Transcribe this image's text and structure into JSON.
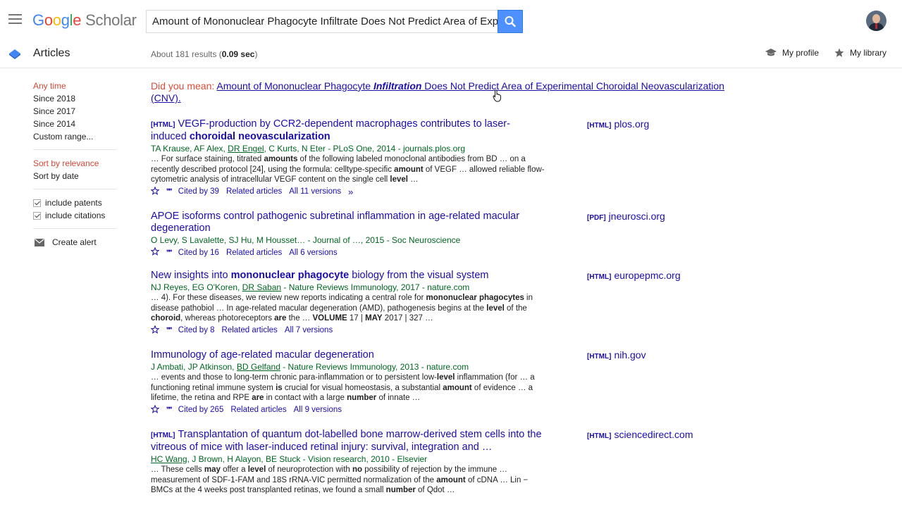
{
  "header": {
    "logo_google": "Google",
    "logo_scholar": "Scholar",
    "search_query": "Amount of Mononuclear Phagocyte Infiltrate Does Not Predict Area of Experi"
  },
  "subbar": {
    "section": "Articles",
    "results_prefix": "About 181 results (",
    "results_time": "0.09 sec",
    "results_suffix": ")",
    "my_profile": "My profile",
    "my_library": "My library"
  },
  "sidebar": {
    "time_filters": [
      "Any time",
      "Since 2018",
      "Since 2017",
      "Since 2014",
      "Custom range..."
    ],
    "sort": [
      "Sort by relevance",
      "Sort by date"
    ],
    "include_patents": "include patents",
    "include_citations": "include citations",
    "create_alert": "Create alert"
  },
  "did_you_mean": {
    "prefix": "Did you mean:",
    "pre": "Amount of Mononuclear Phagocyte ",
    "bold": "Infiltration",
    "post": " Does Not Predict Area of Experimental Choroidal Neovascularization (CNV)."
  },
  "results": [
    {
      "tag": "[HTML]",
      "title_pre": "VEGF-production by CCR2-dependent macrophages contributes to laser-induced ",
      "title_bold": "choroidal neovascularization",
      "authors_pre": "TA Krause, AF Alex, ",
      "authors_link": "DR Engel",
      "authors_post": ", C Kurts, N Eter - PLoS One, 2014 - journals.plos.org",
      "snippet_html": "… For surface staining, titrated <b>amounts</b> of the following labeled monoclonal antibodies from BD … on a recently described protocol [24], using the formula: celltype-specific <b>amount</b> of VEGF … allowed reliable flow-cytometric analysis of intracellular VEGF content on the single cell <b>level</b> …",
      "cited": "Cited by 39",
      "related": "Related articles",
      "versions": "All 11 versions",
      "side_tag": "[HTML]",
      "side_site": "plos.org"
    },
    {
      "tag": "",
      "title_pre": "APOE isoforms control pathogenic subretinal inflammation in age-related macular degeneration",
      "title_bold": "",
      "authors_pre": "O Levy, S Lavalette, SJ Hu, M Housset… - Journal of …, 2015 - Soc Neuroscience",
      "authors_link": "",
      "authors_post": "",
      "snippet_html": "",
      "cited": "Cited by 16",
      "related": "Related articles",
      "versions": "All 6 versions",
      "side_tag": "[PDF]",
      "side_site": "jneurosci.org"
    },
    {
      "tag": "",
      "title_pre": "New insights into ",
      "title_bold": "mononuclear phagocyte",
      "title_post": " biology from the visual system",
      "authors_pre": "NJ Reyes, EG O'Koren, ",
      "authors_link": "DR Saban",
      "authors_post": " - Nature Reviews Immunology, 2017 - nature.com",
      "snippet_html": "… 4). For these diseases, we review new reports indicating a central role for <b>mononuclear phagocytes</b> in disease pathobiol … In age-related macular degeneration (AMD), pathogenesis begins at the <b>level</b> of the <b>choroid</b>, whereas photoreceptors <b>are</b> the … <b>VOLUME</b> 17 | <b>MAY</b> 2017 | 327 …",
      "cited": "Cited by 8",
      "related": "Related articles",
      "versions": "All 7 versions",
      "side_tag": "[HTML]",
      "side_site": "europepmc.org"
    },
    {
      "tag": "",
      "title_pre": "Immunology of age-related macular degeneration",
      "title_bold": "",
      "authors_pre": "J Ambati, JP Atkinson, ",
      "authors_link": "BD Gelfand",
      "authors_post": " - Nature Reviews Immunology, 2013 - nature.com",
      "snippet_html": "… events and those to long-term chronic para-inflammation or to persistent low-<b>level</b> inflammation (for … a functioning retinal immune system <b>is</b> crucial for visual homeostasis, a substantial <b>amount</b> of evidence … a lifetime, the retina and RPE <b>are</b> in contact with a large <b>number</b> of innate …",
      "cited": "Cited by 265",
      "related": "Related articles",
      "versions": "All 9 versions",
      "side_tag": "[HTML]",
      "side_site": "nih.gov"
    },
    {
      "tag": "[HTML]",
      "title_pre": "Transplantation of quantum dot-labelled bone marrow-derived stem cells into the vitreous of mice with laser-induced retinal injury: survival, integration and …",
      "title_bold": "",
      "authors_pre": "",
      "authors_link": "HC Wang",
      "authors_post": ", J Brown, H Alayon, BE Stuck - Vision research, 2010 - Elsevier",
      "snippet_html": "… These cells <b>may</b> offer a <b>level</b> of neuroprotection with <b>no</b> possibility of rejection by the immune … measurement of SDF-1-FAM and 18S rRNA-VIC permitted normalization of the <b>amount</b> of cDNA … Lin − BMCs at the 4 weeks post transplanted retinas, we found a small <b>number</b> of Qdot …",
      "cited": "",
      "related": "",
      "versions": "",
      "side_tag": "[HTML]",
      "side_site": "sciencedirect.com"
    }
  ]
}
